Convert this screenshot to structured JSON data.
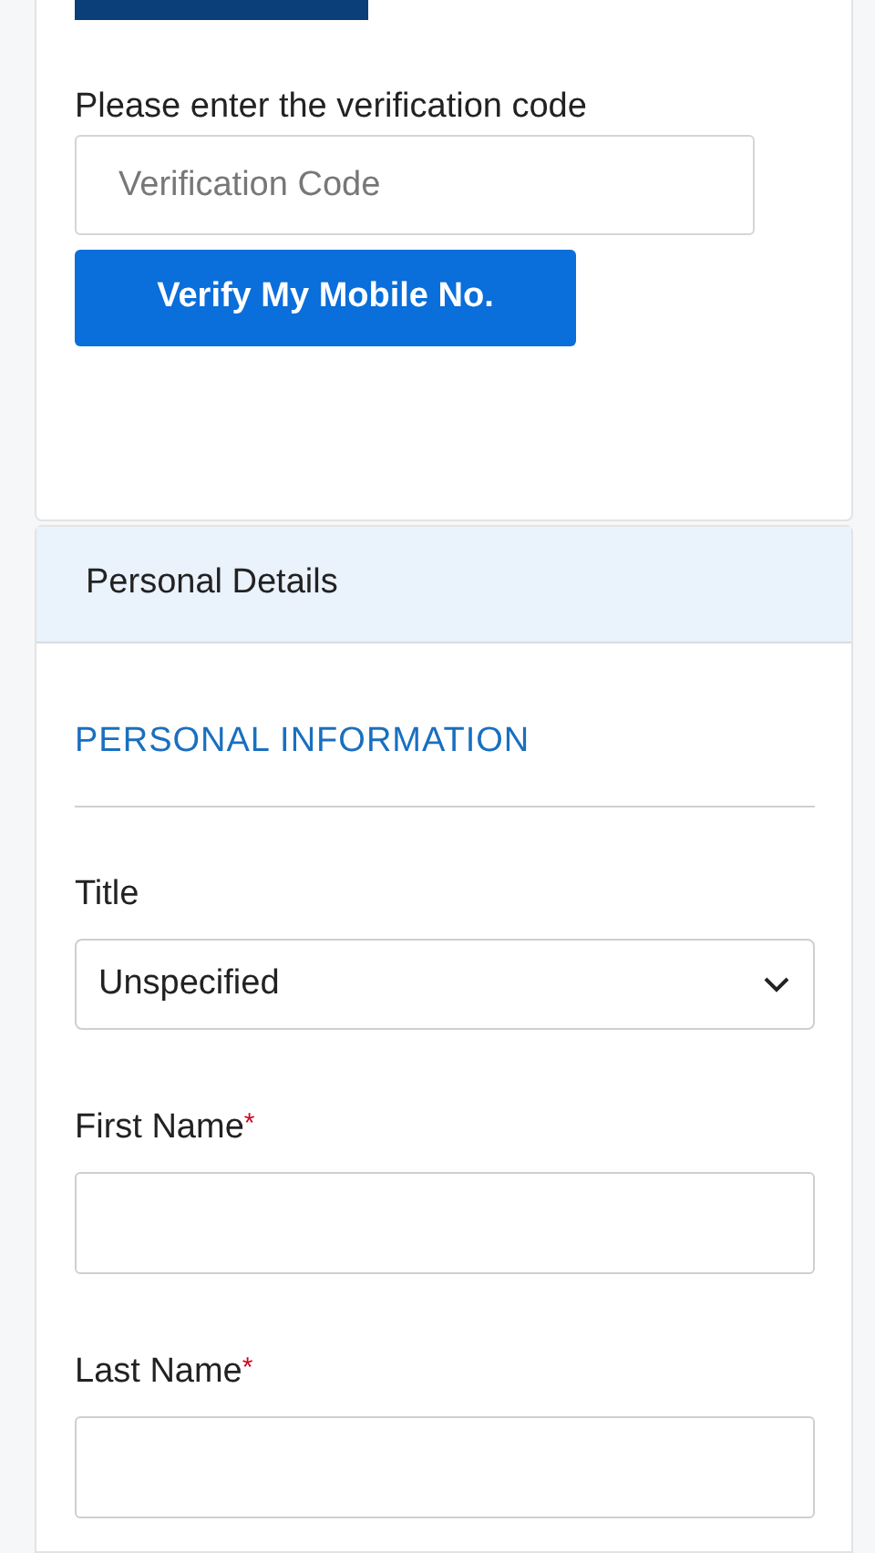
{
  "verification": {
    "label": "Please enter the verification code",
    "code_field": {
      "placeholder": "Verification Code"
    },
    "verify_button": "Verify My Mobile No."
  },
  "personal_details": {
    "header": "Personal Details",
    "section_title": "PERSONAL INFORMATION",
    "fields": [
      {
        "kind": "select",
        "label": "Title",
        "value": "Unspecified"
      },
      {
        "kind": "text",
        "label": "First Name",
        "required_mark": "*"
      },
      {
        "kind": "text",
        "label": "Last Name",
        "required_mark": "*"
      }
    ]
  }
}
